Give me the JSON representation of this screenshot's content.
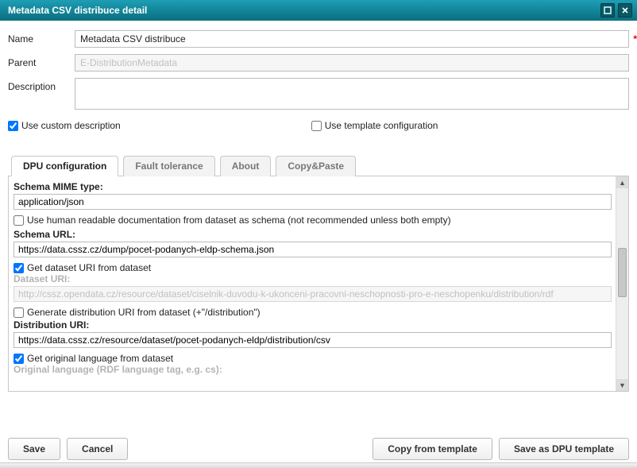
{
  "window": {
    "title": "Metadata CSV distribuce detail"
  },
  "form": {
    "name_label": "Name",
    "name_value": "Metadata CSV distribuce",
    "parent_label": "Parent",
    "parent_value": "E-DistributionMetadata",
    "description_label": "Description",
    "description_value": "",
    "use_custom_description_label": "Use custom description",
    "use_template_configuration_label": "Use template configuration"
  },
  "tabs": {
    "items": [
      {
        "label": "DPU configuration"
      },
      {
        "label": "Fault tolerance"
      },
      {
        "label": "About"
      },
      {
        "label": "Copy&Paste"
      }
    ]
  },
  "config": {
    "schema_mime_label": "Schema MIME type:",
    "schema_mime_value": "application/json",
    "use_human_readable_label": "Use human readable documentation from dataset as schema (not recommended unless both empty)",
    "schema_url_label": "Schema URL:",
    "schema_url_value": "https://data.cssz.cz/dump/pocet-podanych-eldp-schema.json",
    "get_dataset_uri_label": "Get dataset URI from dataset",
    "dataset_uri_label": "Dataset URI:",
    "dataset_uri_value": "http://cssz.opendata.cz/resource/dataset/ciselnik-duvodu-k-ukonceni-pracovni-neschopnosti-pro-e-neschopenku/distribution/rdf",
    "generate_distribution_label": "Generate distribution URI from dataset (+\"/distribution\")",
    "distribution_uri_label": "Distribution URI:",
    "distribution_uri_value": "https://data.cssz.cz/resource/dataset/pocet-podanych-eldp/distribution/csv",
    "get_original_lang_label": "Get original language from dataset",
    "original_lang_label": "Original language (RDF language tag, e.g. cs):"
  },
  "buttons": {
    "save": "Save",
    "cancel": "Cancel",
    "copy_from_template": "Copy from template",
    "save_as_dpu_template": "Save as DPU template"
  }
}
